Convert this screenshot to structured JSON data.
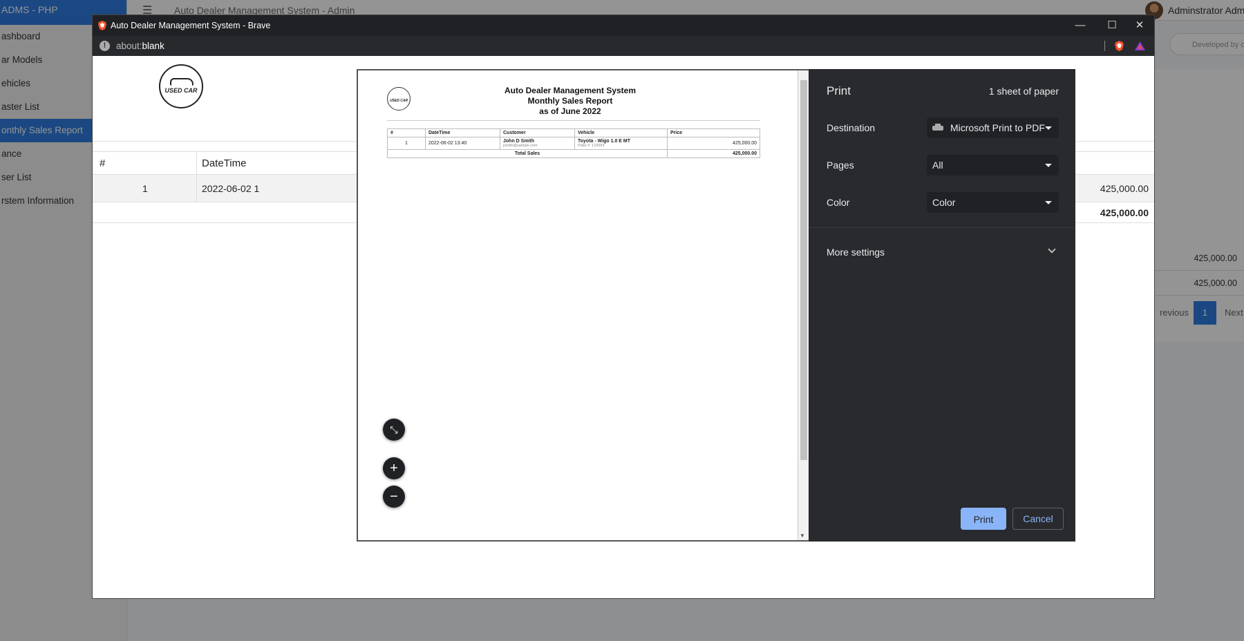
{
  "background_app": {
    "brand": "ADMS - PHP",
    "nav_items": [
      {
        "label": "ashboard",
        "active": false
      },
      {
        "label": "ar Models",
        "active": false
      },
      {
        "label": "ehicles",
        "active": false
      },
      {
        "label": "aster List",
        "active": false
      },
      {
        "label": "onthly Sales Report",
        "active": true
      },
      {
        "label": "ance",
        "active": false
      },
      {
        "label": "ser List",
        "active": false
      },
      {
        "label": "rstem Information",
        "active": false
      }
    ],
    "page_title": "Auto Dealer Management System - Admin",
    "user_name": "Adminstrator Admin",
    "developed_by": "Developed by o",
    "rows": [
      {
        "price": "425,000.00"
      },
      {
        "price": "425,000.00"
      }
    ],
    "pager": {
      "previous": "revious",
      "current": "1",
      "next": "Next"
    }
  },
  "window": {
    "title": "Auto Dealer Management System - Brave",
    "address_scheme": "about:",
    "address_host": "blank",
    "controls": {
      "minimize": "—",
      "maximize": "☐",
      "close": "✕"
    }
  },
  "page_behind": {
    "logo_text": "USED CAR",
    "columns": [
      "#",
      "DateTime"
    ],
    "row": {
      "num": "1",
      "datetime": "2022-06-02 1",
      "price": "425,000.00"
    },
    "total": "425,000.00"
  },
  "preview": {
    "logo_text": "USED CAR",
    "heading_lines": [
      "Auto Dealer Management System",
      "Monthly Sales Report",
      "as of June 2022"
    ],
    "columns": [
      "#",
      "DateTime",
      "Customer",
      "Vehicle",
      "Price"
    ],
    "rows": [
      {
        "num": "1",
        "datetime": "2022-06-02 13:40",
        "customer": "John D Smith",
        "email": "jsmith@sample.com",
        "vehicle": "Toyota - Wigo 1.0 E MT",
        "plate": "Plate #: 123654",
        "price": "425,000.00"
      }
    ],
    "total_label": "Total Sales",
    "total_value": "425,000.00",
    "zoom_fit": "⤡",
    "zoom_in": "+",
    "zoom_out": "−"
  },
  "print_panel": {
    "title": "Print",
    "sheet_count": "1 sheet of paper",
    "destination_label": "Destination",
    "destination_value": "Microsoft Print to PDF",
    "pages_label": "Pages",
    "pages_value": "All",
    "color_label": "Color",
    "color_value": "Color",
    "more_settings": "More settings",
    "print_button": "Print",
    "cancel_button": "Cancel"
  }
}
